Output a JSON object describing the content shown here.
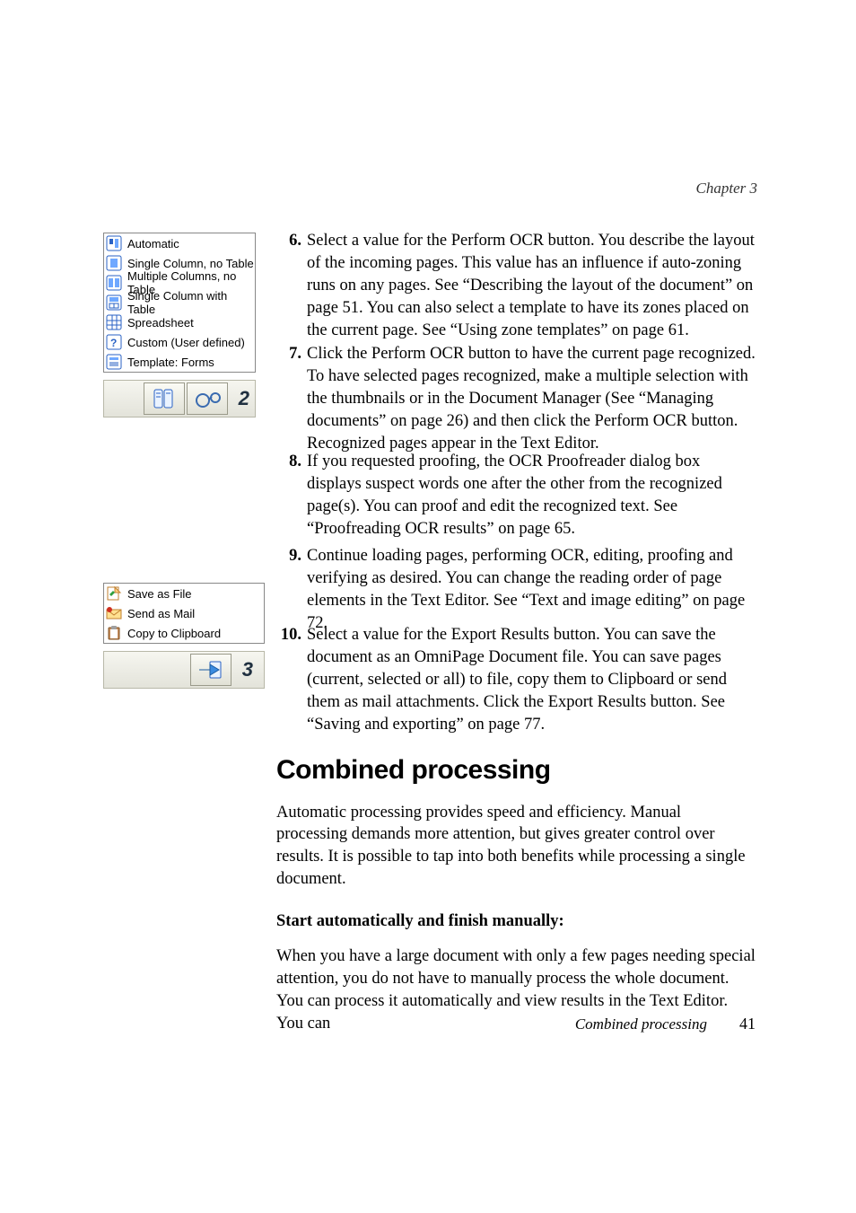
{
  "header": {
    "chapter": "Chapter 3"
  },
  "sidebar": {
    "menu_layout": {
      "items": [
        "Automatic",
        "Single Column, no Table",
        "Multiple Columns, no Table",
        "Single Column with Table",
        "Spreadsheet",
        "Custom (User defined)",
        "Template: Forms"
      ],
      "step_number": "2"
    },
    "menu_export": {
      "items": [
        "Save as File",
        "Send as Mail",
        "Copy to Clipboard"
      ],
      "step_number": "3"
    }
  },
  "steps": {
    "s6": {
      "num": "6.",
      "text": "Select a value for the Perform OCR button. You describe the layout of the incoming pages. This value has an influence if auto-zoning runs on any pages. See “Describing the layout of the document” on page 51. You can also select a template to have its zones placed on the current page. See “Using zone templates” on page 61."
    },
    "s7": {
      "num": "7.",
      "text": "Click the Perform OCR button to have the current page recognized. To have selected pages recognized, make a multiple selection with the thumbnails or in the Document Manager (See “Managing documents” on page 26) and then click the Perform OCR button. Recognized pages appear in the Text Editor."
    },
    "s8": {
      "num": "8.",
      "text": "If you requested proofing, the OCR Proofreader dialog box displays suspect words one after the other from the recognized page(s). You can proof and edit the recognized text. See “Proofreading OCR results” on page 65."
    },
    "s9": {
      "num": "9.",
      "text": "Continue loading pages, performing OCR, editing, proofing and verifying as desired. You can change the reading order of page elements in the Text Editor. See “Text and image editing” on page 72."
    },
    "s10": {
      "num": "10.",
      "text": "Select a value for the Export Results button. You can save the document as an OmniPage Document file. You can save pages (current, selected or all) to file, copy them to Clipboard or send them as mail attachments. Click the Export Results button. See “Saving and exporting” on page 77."
    }
  },
  "section": {
    "heading": "Combined processing",
    "para1": "Automatic processing provides speed and efficiency. Manual processing demands more attention, but gives greater control over results. It is possible to tap into both benefits while processing a single document.",
    "sub_bold": "Start automatically and finish manually:",
    "para2": "When you have a large document with only a few pages needing special attention, you do not have to manually process the whole document. You can process it automatically and view results in the Text Editor. You can"
  },
  "footer": {
    "title": "Combined processing",
    "page": "41"
  }
}
